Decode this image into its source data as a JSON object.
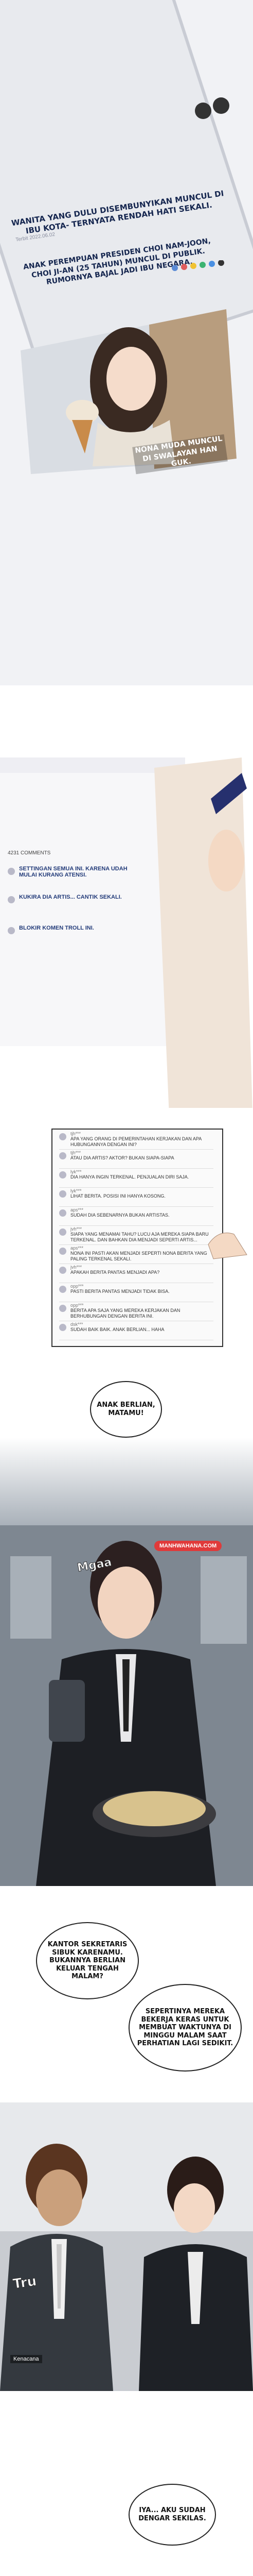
{
  "panel1": {
    "caption_1": "WANITA YANG DULU DISEMBUNYIKAN MUNCUL DI IBU KOTA- TERNYATA RENDAH HATI SEKALI.",
    "caption_2": "ANAK PEREMPUAN PRESIDEN CHOI NAM-JOON, CHOI JI-AN (25 TAHUN) MUNCUL DI PUBLIK. RUMORNYA BAJAL JADI IBU NEGARA.",
    "caption_3": "NONA MUDA MUNCUL DI SWALAYAN HAN GUK.",
    "date": "Terbit 2022.06.02"
  },
  "panel2": {
    "header": "4231 COMMENTS",
    "comments": [
      {
        "text": "SETTINGAN SEMUA INI. KARENA UDAH MULAI KURANG ATENSI."
      },
      {
        "text": "KUKIRA DIA ARTIS... CANTIK SEKALI."
      },
      {
        "text": "BLOKIR KOMEN TROLL INI."
      }
    ]
  },
  "panel3": {
    "comments": [
      {
        "user": "tjh***",
        "text": "APA YANG ORANG DI PEMERINTAHAN KERJAKAN DAN APA HUBUNGANNYA DENGAN INI?"
      },
      {
        "user": "tjh***",
        "text": "ATAU DIA ARTIS? AKTOR? BUKAN SIAPA-SIAPA"
      },
      {
        "user": "lyk***",
        "text": "DIA HANYA INGIN TERKENAL. PENJUALAN DIRI SAJA."
      },
      {
        "user": "lyk***",
        "text": "LIHAT BERITA. POSISI INI HANYA KOSONG."
      },
      {
        "user": "aps***",
        "text": "SUDAH DIA SEBENARNYA BUKAN ARTISTAS."
      },
      {
        "user": "jvh***",
        "text": "SIAPA YANG MENAMAI TAHU? LUCU AJA MEREKA SIAPA BARU TERKENAL. DAN BAHKAN DIA MENJADI SEPERTI ARTIS..."
      },
      {
        "user": "aps***",
        "text": "NONA INI PASTI AKAN MENJADI SEPERTI NONA BERITA YANG PALING TERKENAL SEKALI."
      },
      {
        "user": "jvh***",
        "text": "APAKAH BERITA PANTAS MENJADI APA?"
      },
      {
        "user": "opp***",
        "text": "PASTI BERITA PANTAS MENJADI TIDAK BISA."
      },
      {
        "user": "opp***",
        "text": "BERITA APA SAJA YANG MEREKA KERJAKAN DAN BERHUBUNGAN DENGAN BERITA INI."
      },
      {
        "user": "dsk***",
        "text": "SUDAH BAIK BAIK. ANAK BERLIAN... HAHA"
      }
    ]
  },
  "panel4": {
    "bubble_1": "ANAK BERLIAN, MATAMU!",
    "watermark": "MANHWAHANA.COM",
    "sfx": "Mgaa"
  },
  "panel5": {
    "bubble_1": "KANTOR SEKRETARIS SIBUK KARENAMU. BUKANNYA BERLIAN KELUAR TENGAH MALAM?",
    "bubble_2": "SEPERTINYA MEREKA BEKERJA KERAS UNTUK MEMBUAT WAKTUNYA DI MINGGU MALAM SAAT PERHATIAN LAGI SEDIKIT.",
    "bubble_3": "IYA... AKU SUDAH DENGAR SEKILAS.",
    "sfx": "Tru",
    "credit": "Kenacana"
  }
}
